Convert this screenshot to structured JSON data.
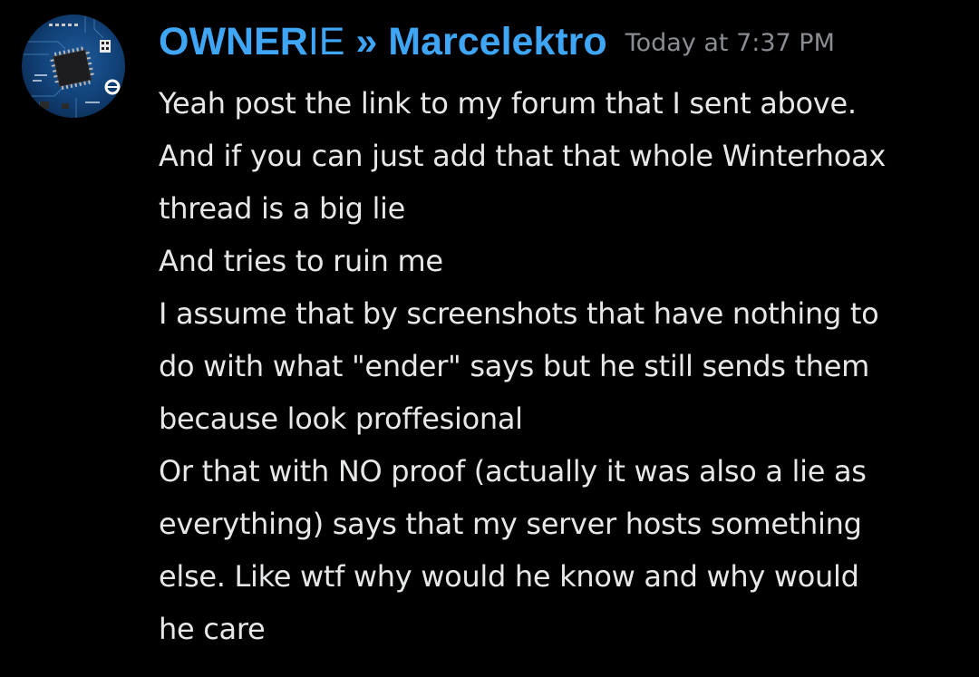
{
  "message": {
    "author_prefix": "OWNER",
    "author_mid": "IE",
    "author_sep": " » ",
    "author_name": "Marcelektro",
    "timestamp": "Today at 7:37 PM",
    "lines": [
      "Yeah post the link to my forum that I sent above.",
      "And if you can just add that that whole Winterhoax",
      "thread is a big lie",
      "And tries to ruin me",
      "I assume that by screenshots that have nothing to",
      "do with what \"ender\" says but he still sends them",
      "because look proffesional",
      "Or that with NO proof (actually it was also a lie as",
      "everything) says that my server hosts something",
      "else. Like wtf why would he know and why would",
      "he care"
    ]
  },
  "colors": {
    "background": "#000000",
    "username": "#3ea6f5",
    "timestamp": "#8a8d92",
    "text": "#e6e7e8"
  }
}
